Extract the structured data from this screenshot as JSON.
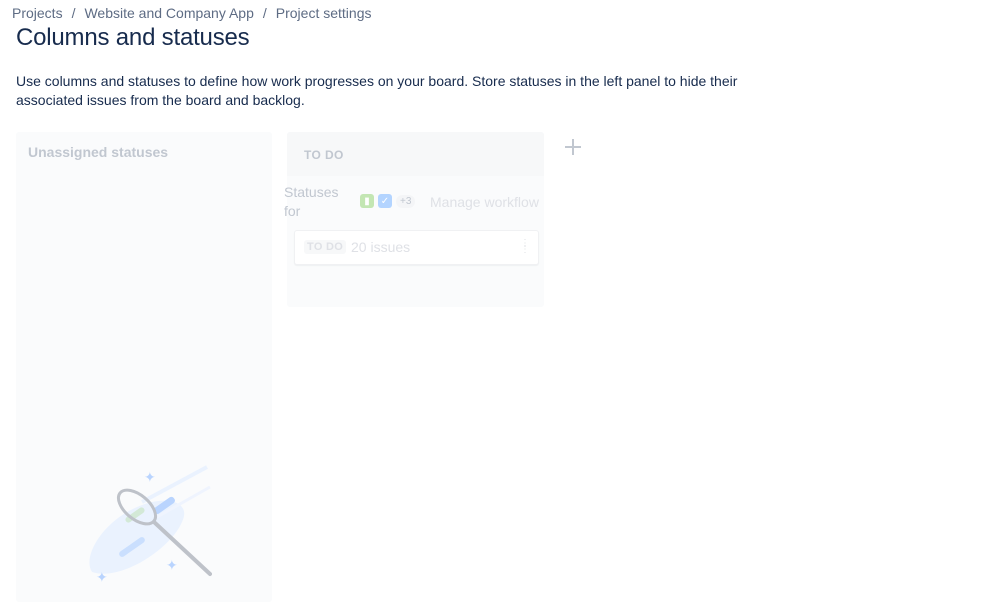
{
  "breadcrumb": {
    "items": [
      "Projects",
      "Website and Company App",
      "Project settings"
    ],
    "separator": "/"
  },
  "page": {
    "title": "Columns and statuses",
    "description": "Use columns and statuses to define how work progresses on your board. Store statuses in the left panel to hide their associated issues from the board and backlog."
  },
  "unassigned": {
    "title": "Unassigned statuses",
    "illustration_icon": "empty-search-racket-icon"
  },
  "column": {
    "name": "TO DO",
    "statuses_for_label": "Statuses for",
    "issue_types": [
      "story-icon",
      "task-icon"
    ],
    "more_types": "+3",
    "manage_workflow": "Manage workflow",
    "status": {
      "lozenge": "TO DO",
      "count": "20 issues"
    }
  },
  "add_column": {
    "icon": "plus-icon"
  },
  "colors": {
    "text": "#172b4d",
    "muted": "#5e6c84",
    "panel": "#fafbfc",
    "faded": "#c1c7d0"
  }
}
